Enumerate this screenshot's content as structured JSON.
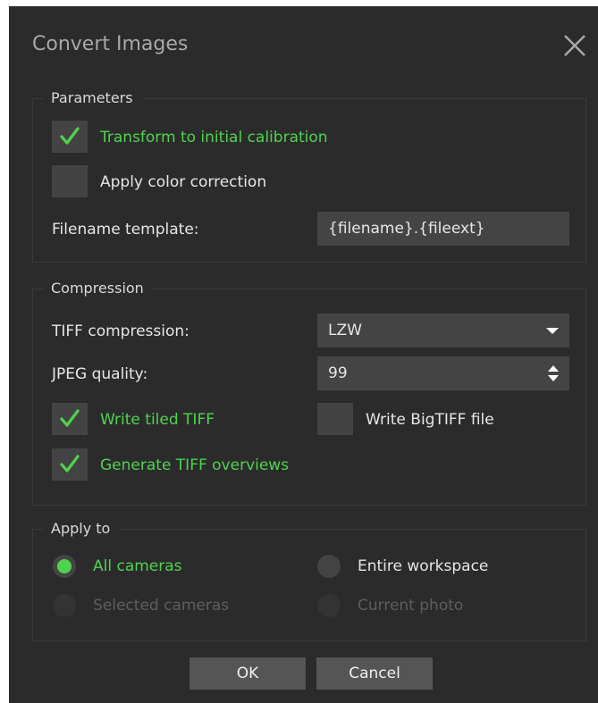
{
  "dialog": {
    "title": "Convert Images",
    "close_icon": "close-icon"
  },
  "parameters": {
    "legend": "Parameters",
    "transform_label": "Transform to initial calibration",
    "transform_checked": true,
    "color_correction_label": "Apply color correction",
    "color_correction_checked": false,
    "filename_template_label": "Filename template:",
    "filename_template_value": "{filename}.{fileext}"
  },
  "compression": {
    "legend": "Compression",
    "tiff_compression_label": "TIFF compression:",
    "tiff_compression_value": "LZW",
    "jpeg_quality_label": "JPEG quality:",
    "jpeg_quality_value": "99",
    "tiled_tiff_label": "Write tiled TIFF",
    "tiled_tiff_checked": true,
    "bigtiff_label": "Write BigTIFF file",
    "bigtiff_checked": false,
    "overviews_label": "Generate TIFF overviews",
    "overviews_checked": true
  },
  "apply_to": {
    "legend": "Apply to",
    "all_cameras_label": "All cameras",
    "all_cameras_selected": true,
    "entire_workspace_label": "Entire workspace",
    "selected_cameras_label": "Selected cameras",
    "current_photo_label": "Current photo"
  },
  "buttons": {
    "ok_label": "OK",
    "cancel_label": "Cancel"
  },
  "colors": {
    "background": "#2b2b2b",
    "accent_green": "#4fd34f",
    "control_bg": "#444444"
  }
}
